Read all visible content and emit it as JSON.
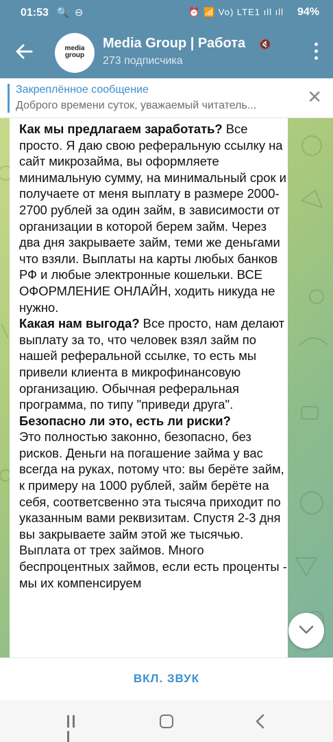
{
  "status_bar": {
    "time": "01:53",
    "left_icons": "🔍 ⊖",
    "right_icons": "⏰ 📶 Vo) LTE1 ıll ıll",
    "battery": "94%"
  },
  "header": {
    "avatar_text_1": "media",
    "avatar_text_2": "group",
    "title": "Media Group | Работа",
    "muted_icon": "🔇",
    "subtitle": "273 подписчика"
  },
  "pinned": {
    "title": "Закреплённое сообщение",
    "text": "Доброго времени суток, уважаемый читатель..."
  },
  "message": {
    "q1": "Как мы предлагаем заработать?",
    "a1": " Все просто. Я даю свою реферальную ссылку на сайт микрозайма, вы оформляете минимальную сумму, на минимальный срок и получаете от меня выплату в размере 2000-2700 рублей за один займ, в зависимости от организации в которой берем займ. Через два дня закрываете займ, теми же деньгами что взяли. Выплаты на карты любых банков РФ и любые электронные кошельки. ВСЕ ОФОРМЛЕНИЕ ОНЛАЙН, ходить никуда не нужно.",
    "q2": "Какая нам выгода?",
    "a2": " Все просто, нам делают выплату за то, что человек взял займ по нашей реферальной ссылке, то есть мы привели клиента в микрофинансовую организацию. Обычная реферальная программа, по типу \"приведи друга\".",
    "q3": "Безопасно ли это, есть ли риски?",
    "a3": "Это полностью законно, безопасно, без рисков. Деньги на погашение займа у вас всегда на руках, потому что: вы берёте займ, к примеру на 1000 рублей, займ берёте на себя, соответсвенно эта тысяча приходит по указанным вами реквизитам. Спустя 2-3 дня вы закрываете займ этой же тысячью. Выплата от трех займов. Много беспроцентных займов, если есть проценты - мы их компенсируем"
  },
  "bottom": {
    "unmute_label": "ВКЛ. ЗВУК"
  },
  "colors": {
    "header_bg": "#5b8fac",
    "accent": "#3d8fcf"
  }
}
